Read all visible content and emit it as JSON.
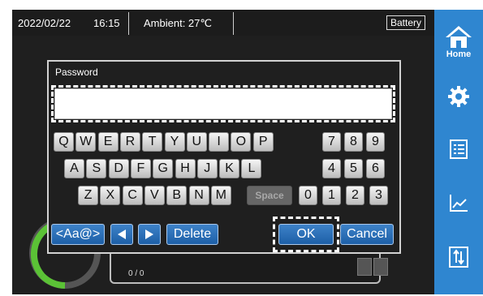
{
  "status": {
    "date": "2022/02/22",
    "time": "16:15",
    "ambient": "Ambient: 27℃",
    "battery": "Battery"
  },
  "sidebar": [
    {
      "icon": "home-icon",
      "label": "Home"
    },
    {
      "icon": "gear-icon",
      "label": ""
    },
    {
      "icon": "list-icon",
      "label": ""
    },
    {
      "icon": "chart-icon",
      "label": ""
    },
    {
      "icon": "transfer-icon",
      "label": ""
    }
  ],
  "background": {
    "page_indicator": "0 / 0"
  },
  "dialog": {
    "title": "Password",
    "input_value": "",
    "keyboard": {
      "row1": [
        "Q",
        "W",
        "E",
        "R",
        "T",
        "Y",
        "U",
        "I",
        "O",
        "P"
      ],
      "row2": [
        "A",
        "S",
        "D",
        "F",
        "G",
        "H",
        "J",
        "K",
        "L"
      ],
      "row3": [
        "Z",
        "X",
        "C",
        "V",
        "B",
        "N",
        "M"
      ],
      "space": "Space",
      "numrow1": [
        "7",
        "8",
        "9"
      ],
      "numrow2": [
        "4",
        "5",
        "6"
      ],
      "numrow3": [
        "0",
        "1",
        "2",
        "3"
      ]
    },
    "buttons": {
      "mode": "<Aa@>",
      "delete": "Delete",
      "ok": "OK",
      "cancel": "Cancel"
    },
    "colors": {
      "accent": "#2f86d0",
      "function_key": "#2a6fb8"
    }
  }
}
